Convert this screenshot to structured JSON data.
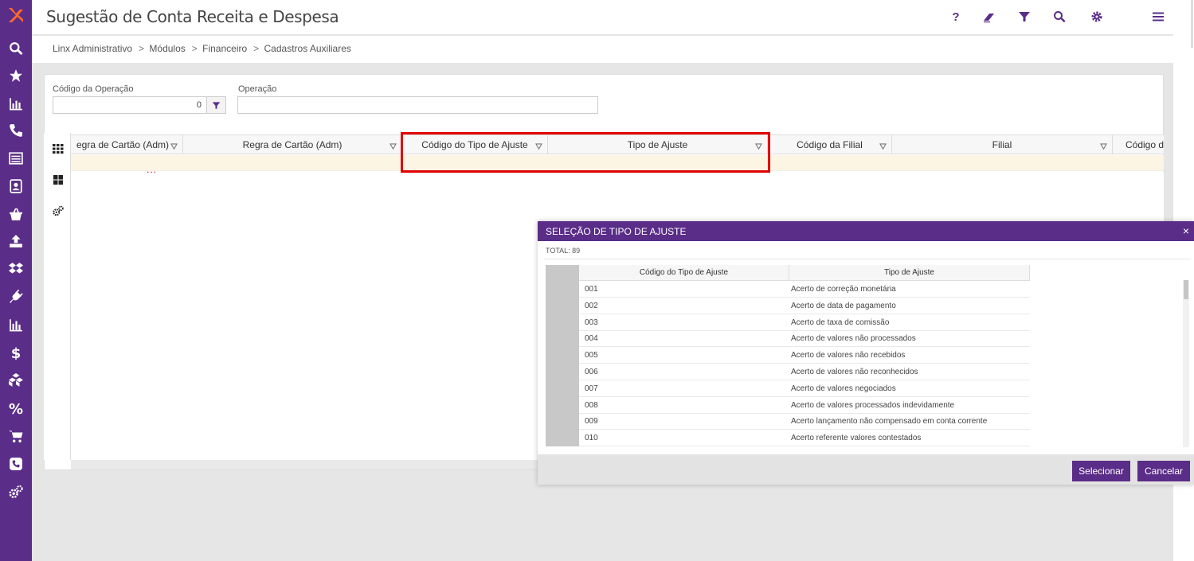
{
  "app": {
    "title": "Sugestão de Conta Receita e Despesa",
    "accent": "#5a2d88"
  },
  "toolbar": {
    "help_label": "?",
    "icons": [
      "help-icon",
      "eraser-icon",
      "filter-icon",
      "search-icon",
      "gear-icon",
      "menu-icon"
    ]
  },
  "sidebar": {
    "icons": [
      "search-icon",
      "star-icon",
      "chart-icon",
      "phone-icon",
      "list-icon",
      "contact-icon",
      "basket-icon",
      "upload-icon",
      "dropbox-icon",
      "plug-icon",
      "bar-chart-icon",
      "dollar-icon",
      "boxes-icon",
      "percent-icon",
      "cart-icon",
      "phone-book-icon",
      "gears-icon"
    ]
  },
  "breadcrumb": [
    "Linx Administrativo",
    "Módulos",
    "Financeiro",
    "Cadastros Auxiliares"
  ],
  "breadcrumb_sep": ">",
  "filters": {
    "codigo_label": "Código da Operação",
    "codigo_value": "0",
    "operacao_label": "Operação",
    "operacao_value": ""
  },
  "grid": {
    "columns": [
      "egra de Cartão (Adm)",
      "Regra de Cartão (Adm)",
      "Código do Tipo de Ajuste",
      "Tipo de Ajuste",
      "Código da Filial",
      "Filial",
      "Código do"
    ],
    "row_marker": "..."
  },
  "modal": {
    "title": "SELEÇÃO DE TIPO DE AJUSTE",
    "close": "×",
    "total": "TOTAL: 89",
    "columns": [
      "Código do Tipo de Ajuste",
      "Tipo de Ajuste"
    ],
    "rows": [
      [
        "001",
        "Acerto de correção monetária"
      ],
      [
        "002",
        "Acerto de data de pagamento"
      ],
      [
        "003",
        "Acerto de taxa de comissão"
      ],
      [
        "004",
        "Acerto de valores não processados"
      ],
      [
        "005",
        "Acerto de valores não recebidos"
      ],
      [
        "006",
        "Acerto de valores não reconhecidos"
      ],
      [
        "007",
        "Acerto de valores negociados"
      ],
      [
        "008",
        "Acerto de valores processados indevidamente"
      ],
      [
        "009",
        "Acerto lançamento não compensado em conta corrente"
      ],
      [
        "010",
        "Acerto referente valores contestados"
      ]
    ],
    "select_label": "Selecionar",
    "cancel_label": "Cancelar"
  }
}
